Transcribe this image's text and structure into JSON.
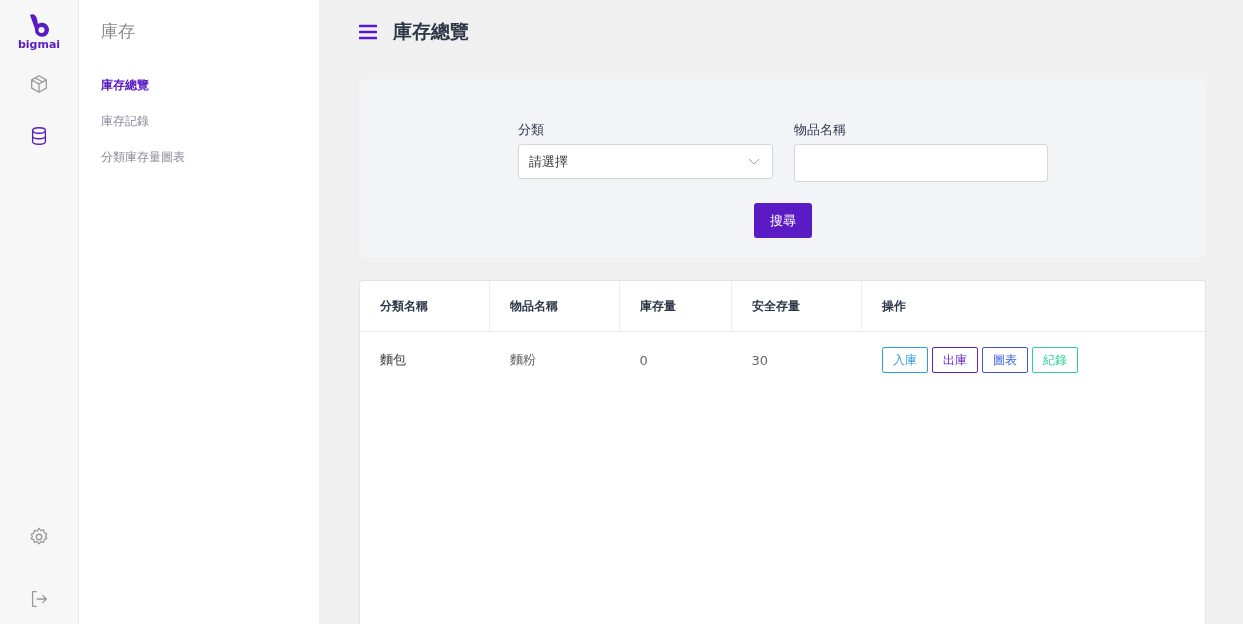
{
  "logo": {
    "text": "bigmai"
  },
  "rail": [
    {
      "kind": "box",
      "selected": false
    },
    {
      "kind": "database",
      "selected": true
    }
  ],
  "rail_bottom": [
    {
      "kind": "settings"
    },
    {
      "kind": "logout"
    }
  ],
  "sidebar": {
    "title": "庫存",
    "items": [
      {
        "label": "庫存總覽",
        "selected": true
      },
      {
        "label": "庫存記錄",
        "selected": false
      },
      {
        "label": "分類庫存量圖表",
        "selected": false
      }
    ]
  },
  "header": {
    "title": "庫存總覽"
  },
  "filters": {
    "category": {
      "label": "分類",
      "value": "請選擇"
    },
    "name": {
      "label": "物品名稱"
    },
    "search_button": "搜尋"
  },
  "table": {
    "columns": [
      "分類名稱",
      "物品名稱",
      "庫存量",
      "安全存量",
      "操作"
    ],
    "rows": [
      {
        "category": "麵包",
        "name": "麵粉",
        "stock": "0",
        "safety": "30",
        "actions": [
          {
            "label": "入庫",
            "color": "#2d9cdb"
          },
          {
            "label": "出庫",
            "color": "#6a1fc2"
          },
          {
            "label": "圖表",
            "color": "#3b5bdb"
          },
          {
            "label": "紀錄",
            "color": "#2ecc9a"
          }
        ]
      }
    ]
  }
}
